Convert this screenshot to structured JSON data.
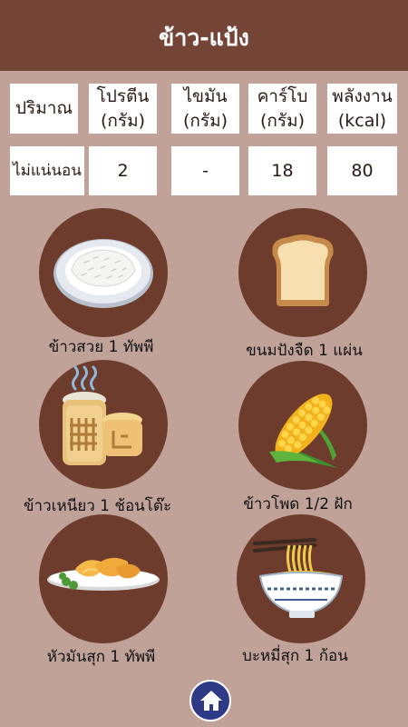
{
  "header": {
    "title": "ข้าว-แป้ง"
  },
  "table": {
    "headers": [
      {
        "line1": "ปริมาณ",
        "line2": ""
      },
      {
        "line1": "โปรตีน",
        "line2": "(กรัม)"
      },
      {
        "line1": "ไขมัน",
        "line2": "(กรัม)"
      },
      {
        "line1": "คาร์โบ",
        "line2": "(กรัม)"
      },
      {
        "line1": "พลังงาน",
        "line2": "(kcal)"
      }
    ],
    "values": [
      "ไม่แน่นอน",
      "2",
      "-",
      "18",
      "80"
    ]
  },
  "foods": [
    {
      "label": "ข้าวสวย 1 ทัพพี",
      "icon": "rice-plate-icon"
    },
    {
      "label": "ขนมปังจืด 1 แผ่น",
      "icon": "bread-slice-icon"
    },
    {
      "label": "ข้าวเหนียว 1 ช้อนโต๊ะ",
      "icon": "sticky-rice-basket-icon"
    },
    {
      "label": "ข้าวโพด 1/2 ฝัก",
      "icon": "corn-icon"
    },
    {
      "label": "หัวมันสุก 1 ทัพพี",
      "icon": "cooked-potato-icon"
    },
    {
      "label": "บะหมี่สุก 1 ก้อน",
      "icon": "noodle-bowl-icon"
    }
  ],
  "nav": {
    "home_icon": "home-icon"
  },
  "colors": {
    "header": "#744536",
    "background": "#c0a299",
    "circle": "#6d3c2d",
    "home_button": "#2e3a86"
  }
}
